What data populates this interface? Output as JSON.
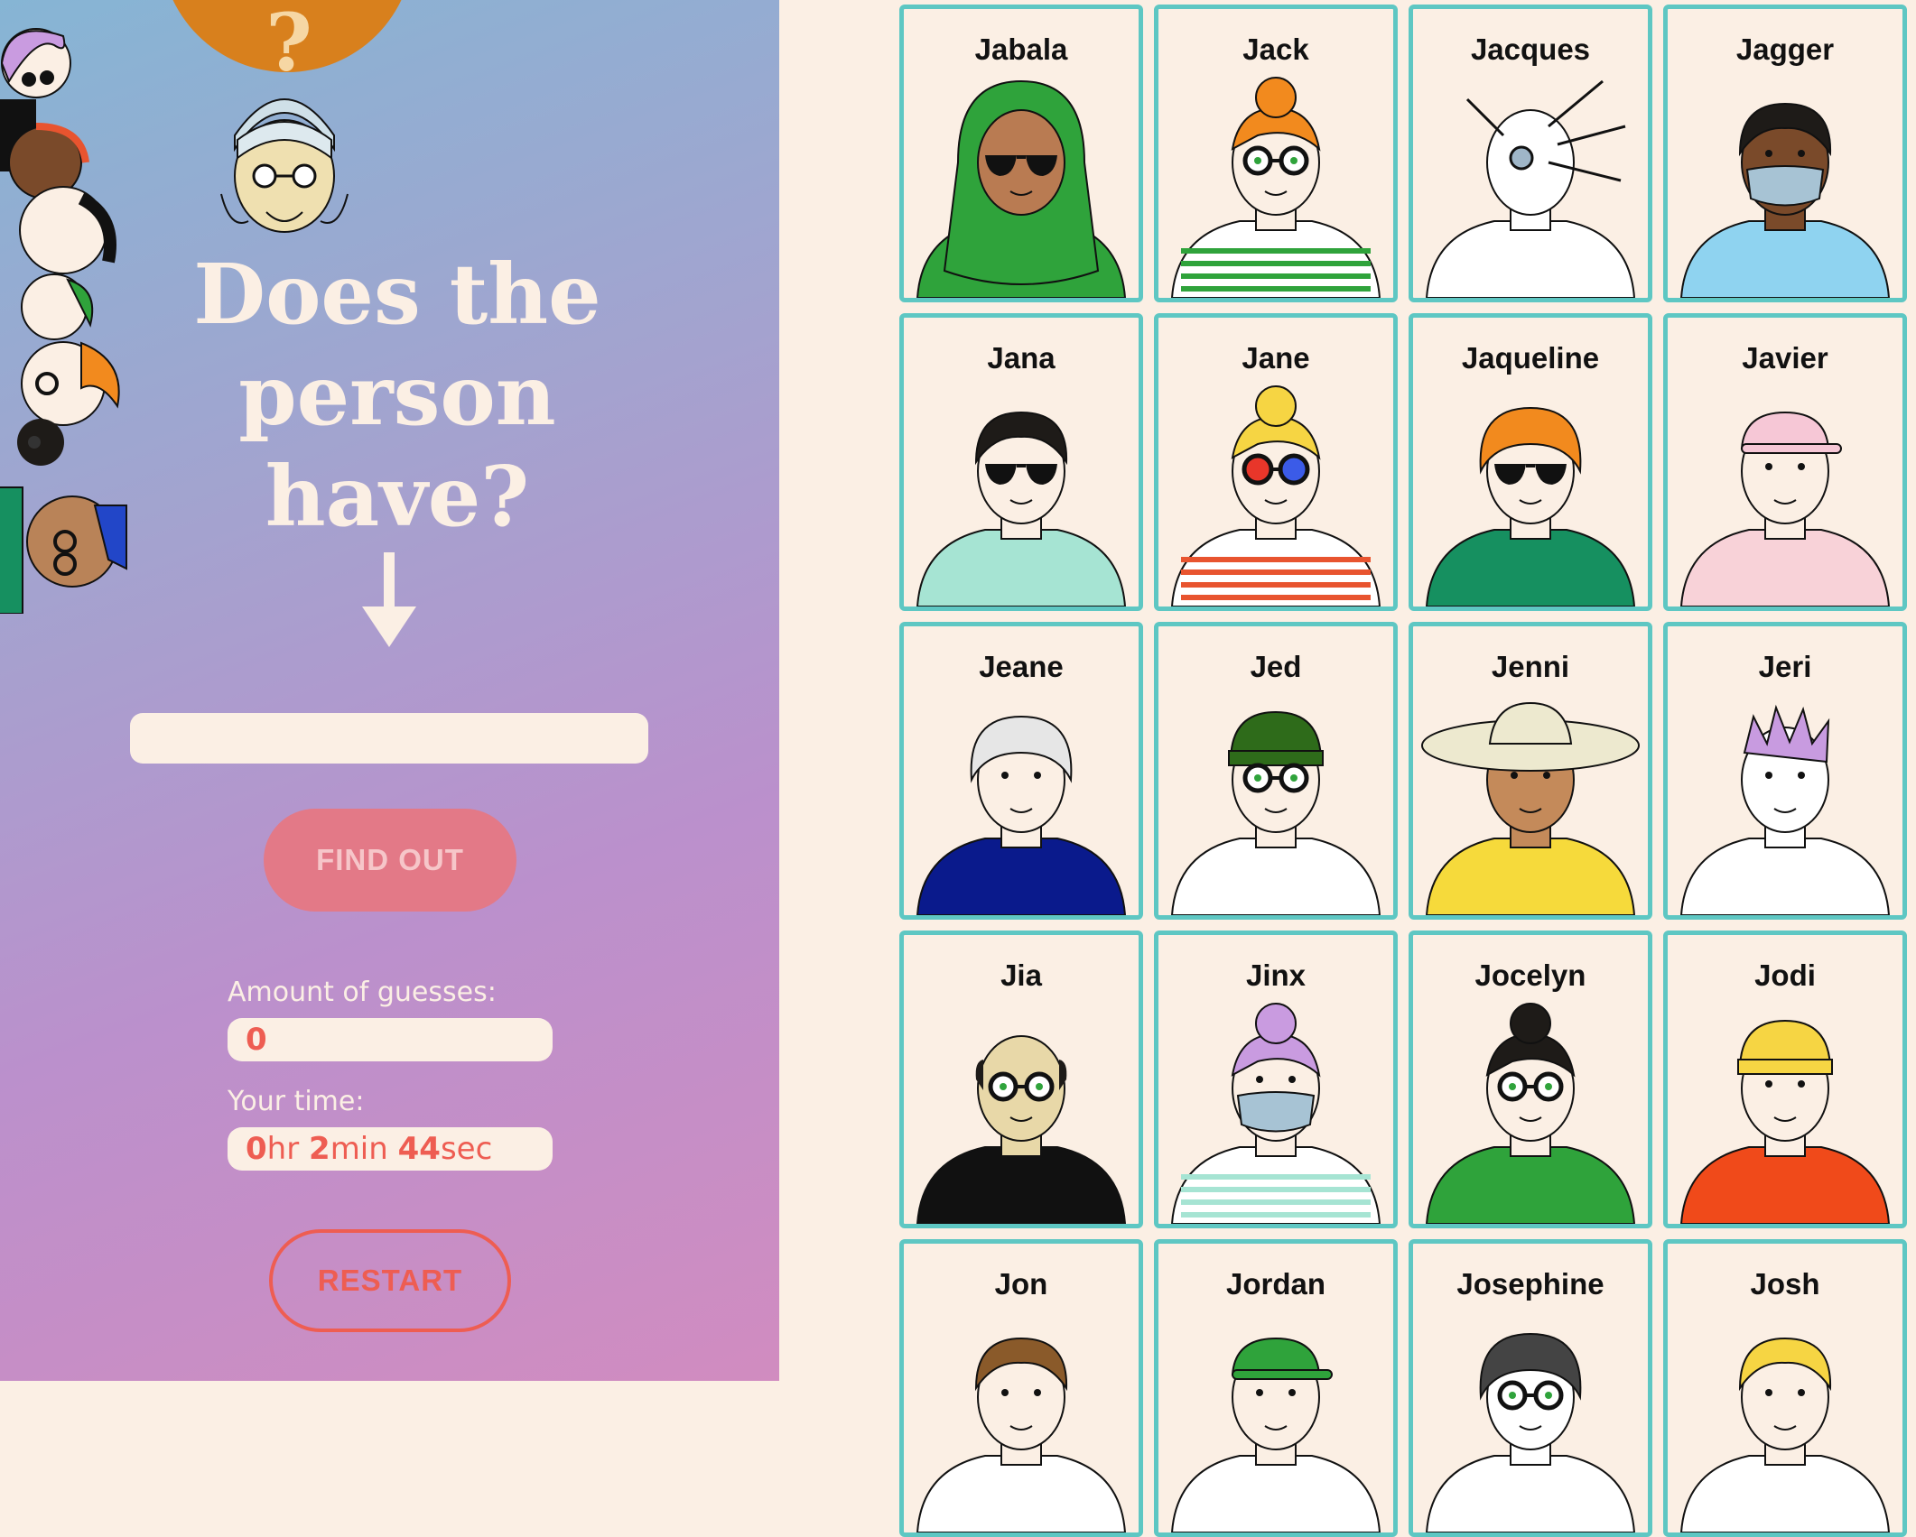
{
  "sidebar": {
    "bubble_mark": "?",
    "headline": [
      "Does the",
      "person",
      "have?"
    ],
    "input_value": "",
    "find_out_label": "FIND OUT",
    "guesses_label": "Amount of guesses:",
    "guesses_value": "0",
    "time_label": "Your time:",
    "time": {
      "hours": "0",
      "hr_unit": "hr",
      "minutes": "2",
      "min_unit": "min",
      "seconds": "44",
      "sec_unit": "sec"
    },
    "restart_label": "RESTART"
  },
  "colors": {
    "card_border": "#5ec7c3",
    "accent": "#ee5d52",
    "cream": "#fbefe4",
    "button": "#e37987"
  },
  "characters": [
    {
      "name": "Jabala",
      "skin": "#b97b52",
      "hair": "#2fa33b",
      "shirt": "#2fa33b",
      "eyes": "sunglasses",
      "top": "hijab"
    },
    {
      "name": "Jack",
      "skin": "#fbefe4",
      "hair": "#f28a1e",
      "shirt": "#ffffff",
      "eyes": "glasses",
      "top": "bun",
      "stripes": "#2fa33b"
    },
    {
      "name": "Jacques",
      "skin": "#ffffff",
      "hair": "#ffffff",
      "shirt": "#ffffff",
      "eyes": "none",
      "top": "creature"
    },
    {
      "name": "Jagger",
      "skin": "#7a4a2a",
      "hair": "#1e1b18",
      "shirt": "#8fd3f0",
      "eyes": "mask",
      "top": "short"
    },
    {
      "name": "Jana",
      "skin": "#fbefe4",
      "hair": "#1e1b18",
      "shirt": "#a6e4d3",
      "eyes": "sunglasses",
      "top": "short"
    },
    {
      "name": "Jane",
      "skin": "#fbefe4",
      "hair": "#f6d543",
      "shirt": "#ffffff",
      "eyes": "3d-glasses",
      "top": "bun",
      "stripes": "#e8542f"
    },
    {
      "name": "Jaqueline",
      "skin": "#fbefe4",
      "hair": "#f28a1e",
      "shirt": "#169060",
      "eyes": "sunglasses",
      "top": "curly"
    },
    {
      "name": "Javier",
      "skin": "#fbefe4",
      "hair": "#f6c7d6",
      "shirt": "#f8d2d8",
      "eyes": "plain",
      "top": "cap"
    },
    {
      "name": "Jeane",
      "skin": "#fbefe4",
      "hair": "#e6e6e6",
      "shirt": "#0a1a8c",
      "eyes": "plain",
      "top": "curly"
    },
    {
      "name": "Jed",
      "skin": "#fbefe4",
      "hair": "#2e6b1a",
      "shirt": "#ffffff",
      "eyes": "glasses",
      "top": "beanie"
    },
    {
      "name": "Jenni",
      "skin": "#c48a5a",
      "hair": "#ede9cf",
      "shirt": "#f6da3b",
      "eyes": "plain",
      "top": "sunhat"
    },
    {
      "name": "Jeri",
      "skin": "#ffffff",
      "hair": "#c89be0",
      "shirt": "#ffffff",
      "eyes": "plain",
      "top": "spiky"
    },
    {
      "name": "Jia",
      "skin": "#e8d8a8",
      "hair": "#1e1b18",
      "shirt": "#111111",
      "eyes": "glasses",
      "top": "bald"
    },
    {
      "name": "Jinx",
      "skin": "#fbefe4",
      "hair": "#c99be0",
      "shirt": "#ffffff",
      "eyes": "mask",
      "top": "bun",
      "stripes": "#a6e4d3"
    },
    {
      "name": "Jocelyn",
      "skin": "#fbefe4",
      "hair": "#1e1b18",
      "shirt": "#2fa33b",
      "eyes": "glasses",
      "top": "bun"
    },
    {
      "name": "Jodi",
      "skin": "#fbefe4",
      "hair": "#f6d543",
      "shirt": "#f04a1a",
      "eyes": "plain",
      "top": "beanie"
    },
    {
      "name": "Jon",
      "skin": "#fbefe4",
      "hair": "#8a5a2a",
      "shirt": "#ffffff",
      "eyes": "plain",
      "top": "short"
    },
    {
      "name": "Jordan",
      "skin": "#fbefe4",
      "hair": "#2fa33b",
      "shirt": "#ffffff",
      "eyes": "plain",
      "top": "cap"
    },
    {
      "name": "Josephine",
      "skin": "#ffffff",
      "hair": "#444444",
      "shirt": "#ffffff",
      "eyes": "glasses",
      "top": "curly"
    },
    {
      "name": "Josh",
      "skin": "#fbefe4",
      "hair": "#f6d543",
      "shirt": "#ffffff",
      "eyes": "plain",
      "top": "short"
    }
  ]
}
